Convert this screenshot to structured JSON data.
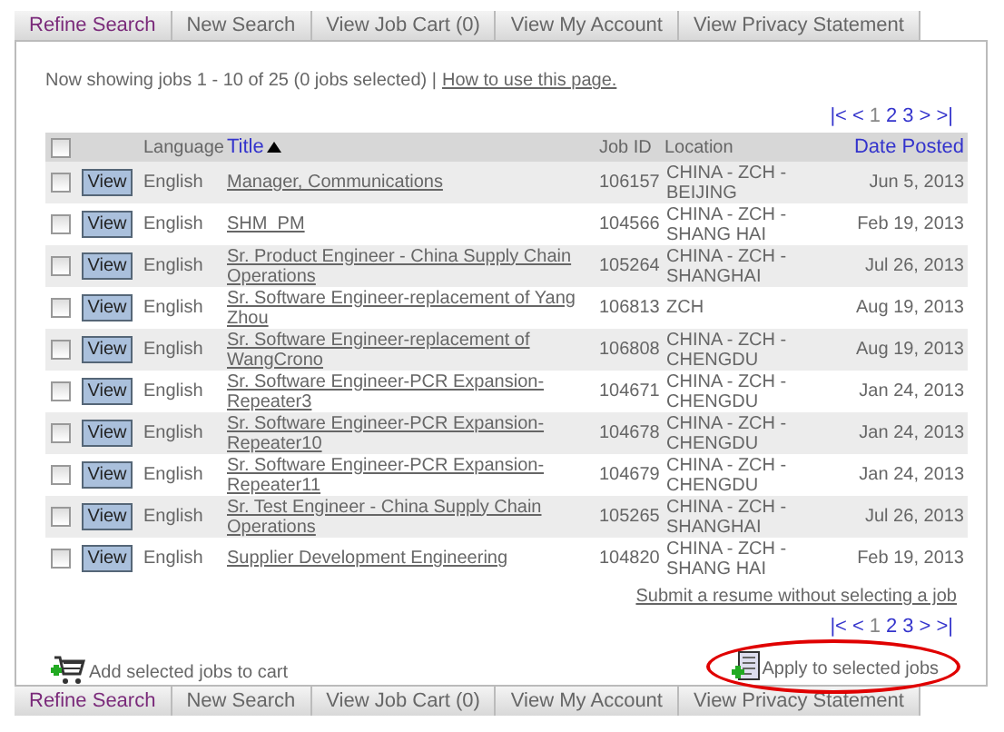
{
  "top_tabs": [
    {
      "label": "Refine Search",
      "selected": true
    },
    {
      "label": "New Search",
      "selected": false
    },
    {
      "label": "View Job Cart (0)",
      "selected": false
    },
    {
      "label": "View My Account",
      "selected": false
    },
    {
      "label": "View Privacy Statement",
      "selected": false
    }
  ],
  "summary": "Now showing jobs 1 - 10 of 25 (0 jobs selected) |",
  "help_link": "How to use this page.",
  "pager_top": [
    {
      "label": "|<",
      "selected": false
    },
    {
      "label": "<",
      "selected": false
    },
    {
      "label": "1",
      "selected": true
    },
    {
      "label": "2",
      "selected": false
    },
    {
      "label": "3",
      "selected": false
    },
    {
      "label": ">",
      "selected": false
    },
    {
      "label": ">|",
      "selected": false
    }
  ],
  "table": {
    "all_checked": false,
    "columns": [
      {
        "label": "Language",
        "sortable": false,
        "sorted": false
      },
      {
        "label": "Title",
        "sortable": true,
        "sorted": true
      },
      {
        "label": "Job ID",
        "sortable": false,
        "sorted": false
      },
      {
        "label": "Location",
        "sortable": false,
        "sorted": false
      },
      {
        "label": "Date Posted",
        "sortable": true,
        "sorted": false
      }
    ],
    "rows": [
      {
        "checked": false,
        "button": "View",
        "language": "English",
        "title": "Manager, Communications",
        "job_id": "106157",
        "location": "CHINA - ZCH - BEIJING",
        "date": "Jun 5, 2013"
      },
      {
        "checked": false,
        "button": "View",
        "language": "English",
        "title": "SHM_PM",
        "job_id": "104566",
        "location": "CHINA - ZCH - SHANG HAI",
        "date": "Feb 19, 2013"
      },
      {
        "checked": false,
        "button": "View",
        "language": "English",
        "title": "Sr. Product Engineer - China Supply Chain Operations",
        "job_id": "105264",
        "location": "CHINA - ZCH - SHANGHAI",
        "date": "Jul 26, 2013"
      },
      {
        "checked": false,
        "button": "View",
        "language": "English",
        "title": "Sr. Software Engineer-replacement of Yang Zhou",
        "job_id": "106813",
        "location": "ZCH",
        "date": "Aug 19, 2013"
      },
      {
        "checked": false,
        "button": "View",
        "language": "English",
        "title": "Sr. Software Engineer-replacement of WangCrono",
        "job_id": "106808",
        "location": "CHINA - ZCH - CHENGDU",
        "date": "Aug 19, 2013"
      },
      {
        "checked": false,
        "button": "View",
        "language": "English",
        "title": "Sr. Software Engineer-PCR Expansion-Repeater3",
        "job_id": "104671",
        "location": "CHINA - ZCH - CHENGDU",
        "date": "Jan 24, 2013"
      },
      {
        "checked": false,
        "button": "View",
        "language": "English",
        "title": "Sr. Software Engineer-PCR Expansion-Repeater10",
        "job_id": "104678",
        "location": "CHINA - ZCH - CHENGDU",
        "date": "Jan 24, 2013"
      },
      {
        "checked": false,
        "button": "View",
        "language": "English",
        "title": "Sr. Software Engineer-PCR Expansion-Repeater11",
        "job_id": "104679",
        "location": "CHINA - ZCH - CHENGDU",
        "date": "Jan 24, 2013"
      },
      {
        "checked": false,
        "button": "View",
        "language": "English",
        "title": "Sr. Test Engineer - China Supply Chain Operations",
        "job_id": "105265",
        "location": "CHINA - ZCH - SHANGHAI",
        "date": "Jul 26, 2013"
      },
      {
        "checked": false,
        "button": "View",
        "language": "English",
        "title": "Supplier Development Engineering",
        "job_id": "104820",
        "location": "CHINA - ZCH - SHANG HAI",
        "date": "Feb 19, 2013"
      }
    ]
  },
  "submit_link": "Submit a resume without selecting a job",
  "pager_bottom": [
    {
      "label": "|<",
      "selected": false
    },
    {
      "label": "<",
      "selected": false
    },
    {
      "label": "1",
      "selected": true
    },
    {
      "label": "2",
      "selected": false
    },
    {
      "label": "3",
      "selected": false
    },
    {
      "label": ">",
      "selected": false
    },
    {
      "label": ">|",
      "selected": false
    }
  ],
  "add_to_cart": "Add selected jobs to cart",
  "apply": {
    "label": "Apply to selected jobs",
    "circled": true
  },
  "bottom_tabs": [
    {
      "label": "Refine Search",
      "selected": true
    },
    {
      "label": "New Search",
      "selected": false
    },
    {
      "label": "View Job Cart (0)",
      "selected": false
    },
    {
      "label": "View My Account",
      "selected": false
    },
    {
      "label": "View Privacy Statement",
      "selected": false
    }
  ]
}
